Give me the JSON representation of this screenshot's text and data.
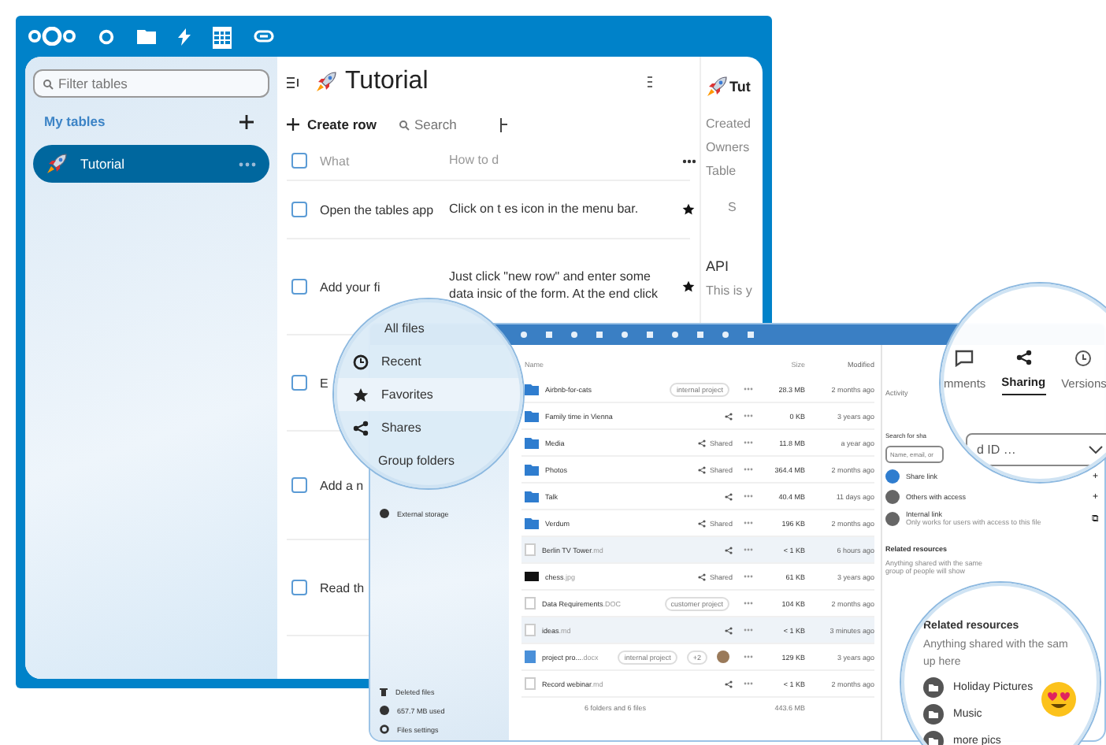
{
  "tables_window": {
    "nav_icons": [
      {
        "kind": "circle",
        "selected": false
      },
      {
        "kind": "folder",
        "selected": false
      },
      {
        "kind": "bolt",
        "selected": false
      },
      {
        "kind": "table",
        "selected": true
      },
      {
        "kind": "link",
        "selected": false
      }
    ],
    "sidebar": {
      "filter_placeholder": "Filter tables",
      "section": "My tables",
      "items": [
        {
          "label": "Tutorial",
          "selected": true
        }
      ]
    },
    "title": "Tutorial",
    "toolbar": {
      "create": "Create row",
      "search_placeholder": "Search"
    },
    "select_all_checked": false,
    "columns": [
      "What",
      "How to d"
    ],
    "rows": [
      {
        "what": "Open the tables app",
        "how": "Click on t  es icon in the menu bar.",
        "checked": false,
        "star": true
      },
      {
        "what": "Add your fi",
        "how": "Just click  \"new row\" and enter some data insic  of the form. At the end click",
        "checked": false,
        "star": true
      },
      {
        "what": "E",
        "checked": false
      },
      {
        "what": "Add a n",
        "checked": false
      },
      {
        "what": "Read th",
        "checked": false
      }
    ],
    "details": {
      "title": "Tut",
      "fields": [
        "Created",
        "Owners",
        "Table"
      ],
      "section": "S",
      "api": "API",
      "api_text": "This is y"
    }
  },
  "files_window": {
    "magnifier_nav": [
      {
        "label": "All files",
        "selected": false
      },
      {
        "label": "Recent",
        "selected": false
      },
      {
        "label": "Favorites",
        "selected": true
      },
      {
        "label": "Shares",
        "selected": false
      },
      {
        "label": "Group folders",
        "selected": false
      }
    ],
    "nav": [
      "External storage"
    ],
    "nav_bottom": [
      "Deleted files",
      "657.7 MB used",
      "Files settings"
    ],
    "columns": {
      "name": "Name",
      "size": "Size",
      "modified": "Modified"
    },
    "rows": [
      {
        "kind": "folder",
        "name": "Airbnb-for-cats",
        "tag": "internal project",
        "shared": false,
        "size": "28.3 MB",
        "modified": "2 months ago",
        "selected": false
      },
      {
        "kind": "folder",
        "name": "Family time in Vienna",
        "shared": true,
        "size": "0 KB",
        "modified": "3 years ago",
        "selected": false
      },
      {
        "kind": "folder",
        "name": "Media",
        "shared": true,
        "share_label": "Shared",
        "size": "11.8 MB",
        "modified": "a year ago",
        "selected": false
      },
      {
        "kind": "folder",
        "name": "Photos",
        "shared": true,
        "share_label": "Shared",
        "size": "364.4 MB",
        "modified": "2 months ago",
        "selected": false
      },
      {
        "kind": "folder",
        "name": "Talk",
        "shared": true,
        "size": "40.4 MB",
        "modified": "11 days ago",
        "selected": false
      },
      {
        "kind": "folder",
        "name": "Verdum",
        "shared": true,
        "share_label": "Shared",
        "size": "196 KB",
        "modified": "2 months ago",
        "selected": false
      },
      {
        "kind": "text",
        "name": "Berlin TV Tower",
        "ext": ".md",
        "shared": true,
        "size": "< 1 KB",
        "modified": "6 hours ago",
        "selected": true
      },
      {
        "kind": "image",
        "name": "chess",
        "ext": ".jpg",
        "shared": true,
        "share_label": "Shared",
        "size": "61 KB",
        "modified": "3 years ago",
        "selected": false
      },
      {
        "kind": "text",
        "name": "Data Requirements",
        "ext": ".DOC",
        "tag": "customer project",
        "shared": false,
        "size": "104 KB",
        "modified": "2 months ago",
        "selected": false
      },
      {
        "kind": "text",
        "name": "ideas",
        "ext": ".md",
        "shared": true,
        "size": "< 1 KB",
        "modified": "3 minutes ago",
        "selected": true
      },
      {
        "kind": "doc",
        "name": "project pro...",
        "ext": ".docx",
        "tag": "internal project",
        "tag_extra": "+2",
        "avatar": true,
        "shared": false,
        "size": "129 KB",
        "modified": "3 years ago",
        "selected": false
      },
      {
        "kind": "text",
        "name": "Record webinar",
        "ext": ".md",
        "shared": true,
        "size": "< 1 KB",
        "modified": "2 months ago",
        "selected": false
      }
    ],
    "summary": "6 folders and 6 files",
    "total": "443.6 MB",
    "panel": {
      "tab": "Activity",
      "search_label": "Search for sha",
      "placeholder": "Name, email, or",
      "entries": [
        {
          "label": "Share link",
          "action": "+"
        },
        {
          "label": "Others with access",
          "action": "+"
        },
        {
          "label": "Internal link",
          "desc": "Only works for users with access to this file",
          "action": "⧉"
        }
      ],
      "related_title": "Related resources",
      "related_text": "Anything shared with the same group of people will show"
    },
    "magnifier_tabs": [
      {
        "label": "mments",
        "selected": false
      },
      {
        "label": "Sharing",
        "selected": true
      },
      {
        "label": "Versions",
        "selected": false
      }
    ],
    "magnifier_field": "d ID …",
    "magnifier_related": {
      "title": "Related resources",
      "text": "Anything shared with the sam up here",
      "items": [
        "Holiday Pictures",
        "Music",
        "more pics"
      ]
    }
  }
}
